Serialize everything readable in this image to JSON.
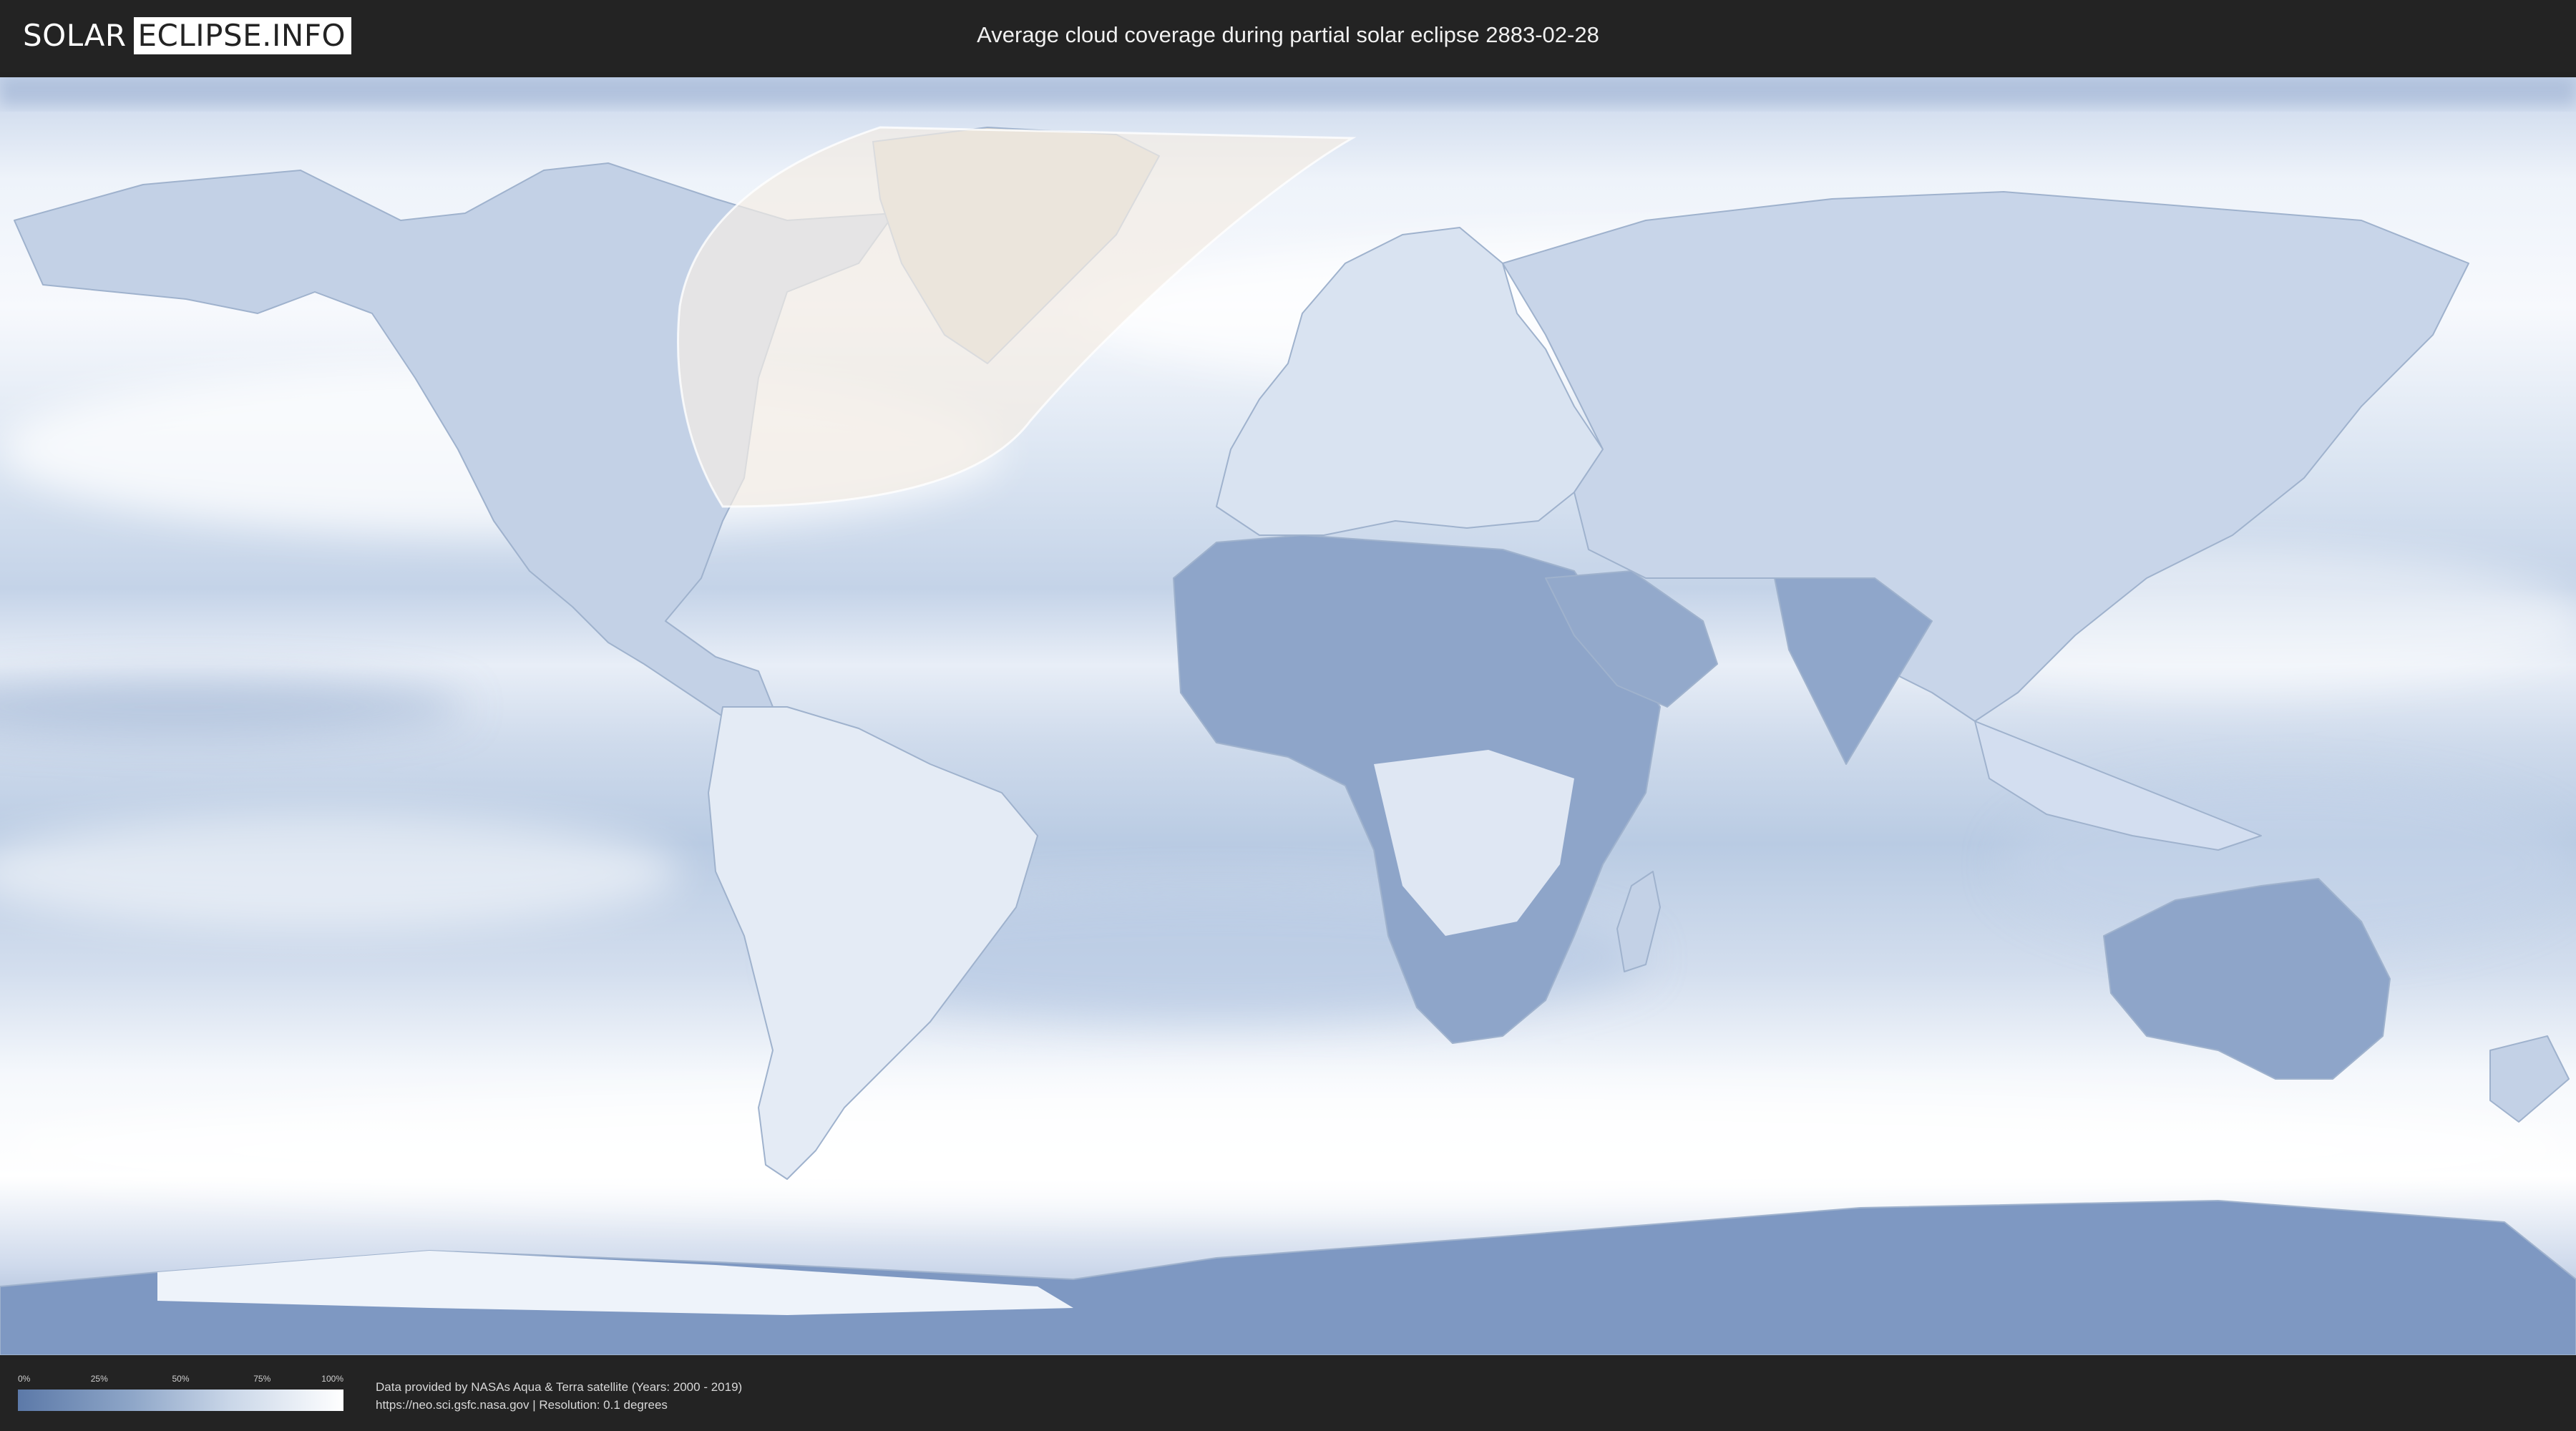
{
  "header": {
    "logo_left": "SOLAR",
    "logo_right": "ECLIPSE.INFO",
    "title": "Average cloud coverage during partial solar eclipse 2883-02-28"
  },
  "map": {
    "projection": "equirectangular",
    "layers": [
      "cloud-coverage",
      "country-borders",
      "eclipse-visibility-zone"
    ],
    "colors": {
      "ocean_clear": "#7e98c2",
      "cloud_white": "#ffffff",
      "eclipse_zone": "#efe8de"
    }
  },
  "footer": {
    "legend": {
      "ticks": [
        "0%",
        "25%",
        "50%",
        "75%",
        "100%"
      ],
      "gradient": [
        "#5c79a8",
        "#8ea6c8",
        "#c9d6e8",
        "#ffffff"
      ]
    },
    "credit_line1": "Data provided by NASAs Aqua & Terra satellite (Years: 2000 - 2019)",
    "credit_line2": "https://neo.sci.gsfc.nasa.gov | Resolution: 0.1 degrees"
  }
}
